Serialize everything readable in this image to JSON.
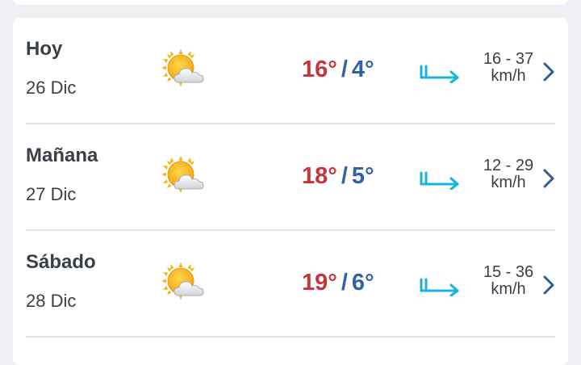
{
  "forecast": [
    {
      "day": "Hoy",
      "date": "26 Dic",
      "max": "16°",
      "sep": "/",
      "min": "4°",
      "wind_range": "16 - 37",
      "wind_unit": "km/h",
      "icon": "partly-cloudy-sun-icon"
    },
    {
      "day": "Mañana",
      "date": "27 Dic",
      "max": "18°",
      "sep": "/",
      "min": "5°",
      "wind_range": "12 - 29",
      "wind_unit": "km/h",
      "icon": "partly-cloudy-sun-icon"
    },
    {
      "day": "Sábado",
      "date": "28 Dic",
      "max": "19°",
      "sep": "/",
      "min": "6°",
      "wind_range": "15 - 36",
      "wind_unit": "km/h",
      "icon": "partly-cloudy-sun-icon"
    }
  ],
  "colors": {
    "max_temp": "#c8343e",
    "min_temp": "#2f63a8",
    "wind_arrow": "#1ab3d9",
    "chevron": "#2d5d93",
    "sun": "#f4b41a"
  }
}
